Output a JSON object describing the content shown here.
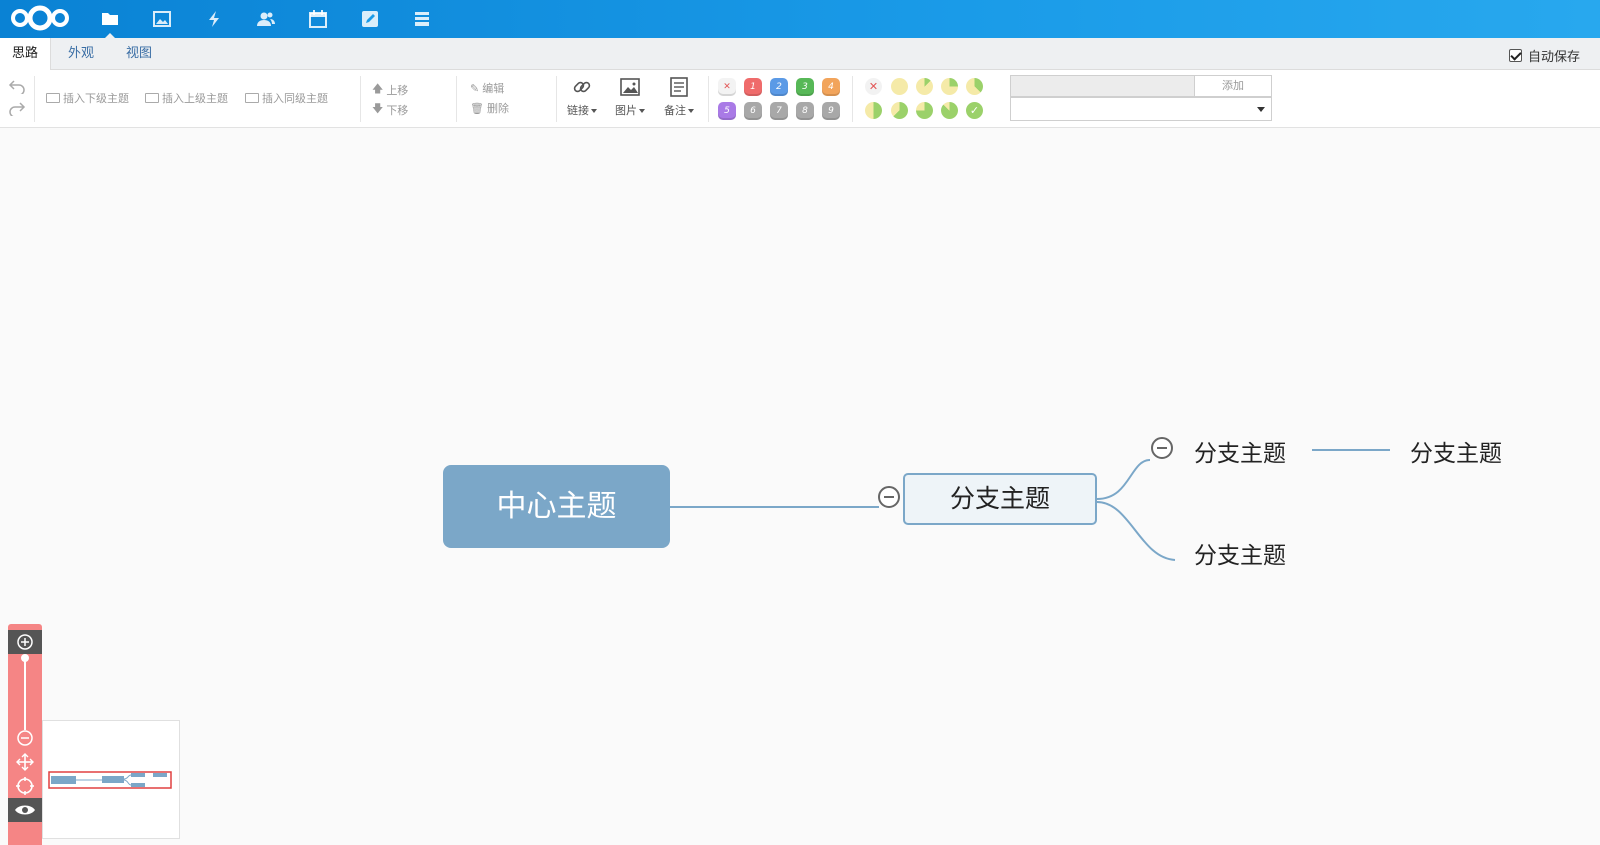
{
  "appbar": {
    "logo": "nextcloud-logo",
    "apps": [
      {
        "name": "files-icon",
        "active": true
      },
      {
        "name": "photos-icon",
        "active": false
      },
      {
        "name": "activity-icon",
        "active": false
      },
      {
        "name": "contacts-icon",
        "active": false
      },
      {
        "name": "calendar-icon",
        "active": false
      },
      {
        "name": "notes-icon",
        "active": false
      },
      {
        "name": "deck-icon",
        "active": false
      }
    ]
  },
  "tabs": [
    "思路",
    "外观",
    "视图"
  ],
  "active_tab": "思路",
  "autosave": {
    "label": "自动保存",
    "checked": true
  },
  "toolbar": {
    "insert_child": "插入下级主题",
    "insert_parent": "插入上级主题",
    "insert_sibling": "插入同级主题",
    "move_up": "上移",
    "move_down": "下移",
    "edit": "编辑",
    "delete": "删除",
    "link": "链接",
    "image": "图片",
    "note": "备注",
    "priorities": [
      "1",
      "2",
      "3",
      "4",
      "5",
      "6",
      "7",
      "8",
      "9"
    ],
    "resource_add": "添加"
  },
  "colors": {
    "accent": "#1a9be8",
    "root_fill": "#7ba7c8",
    "branch_line": "#7ba7c8",
    "zoom_panel": "#f58585"
  },
  "mindmap": {
    "root": "中心主题",
    "main": "分支主题",
    "sub1": "分支主题",
    "sub1_child": "分支主题",
    "sub2": "分支主题"
  }
}
